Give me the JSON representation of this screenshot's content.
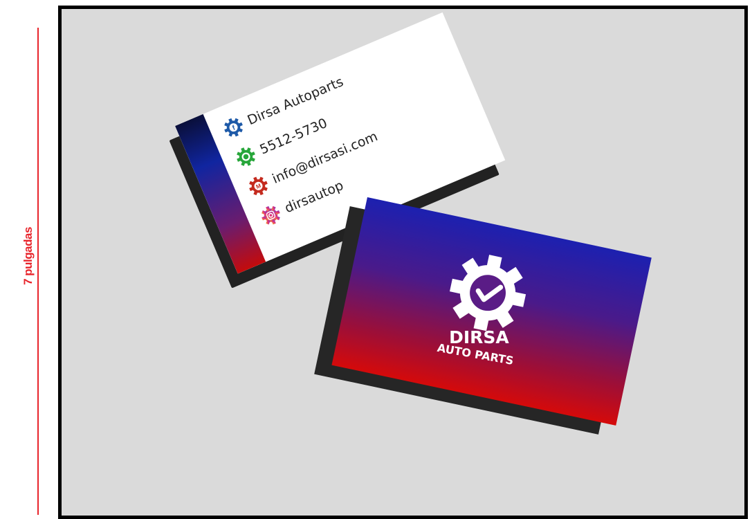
{
  "ruler": {
    "label": "7 pulgadas",
    "color": "#e8242b"
  },
  "back_card": {
    "stripe_colors": [
      "#0a0f3a",
      "#1025a0",
      "#c40b0b"
    ],
    "contacts": [
      {
        "icon": "facebook-gear-icon",
        "text": "Dirsa Autoparts",
        "color": "#1e5aa8"
      },
      {
        "icon": "whatsapp-gear-icon",
        "text": "5512-5730",
        "color": "#27a63a"
      },
      {
        "icon": "gmail-gear-icon",
        "text": "info@dirsasi.com",
        "color": "#c42a1e"
      },
      {
        "icon": "instagram-gear-icon",
        "text": "dirsautop",
        "color": "#e07a1a"
      }
    ]
  },
  "front_card": {
    "logo_icon": "gear-check-icon",
    "brand_name": "DIRSA",
    "brand_sub": "AUTO PARTS",
    "gradient": [
      "#1c20b0",
      "#d50a0a"
    ]
  }
}
